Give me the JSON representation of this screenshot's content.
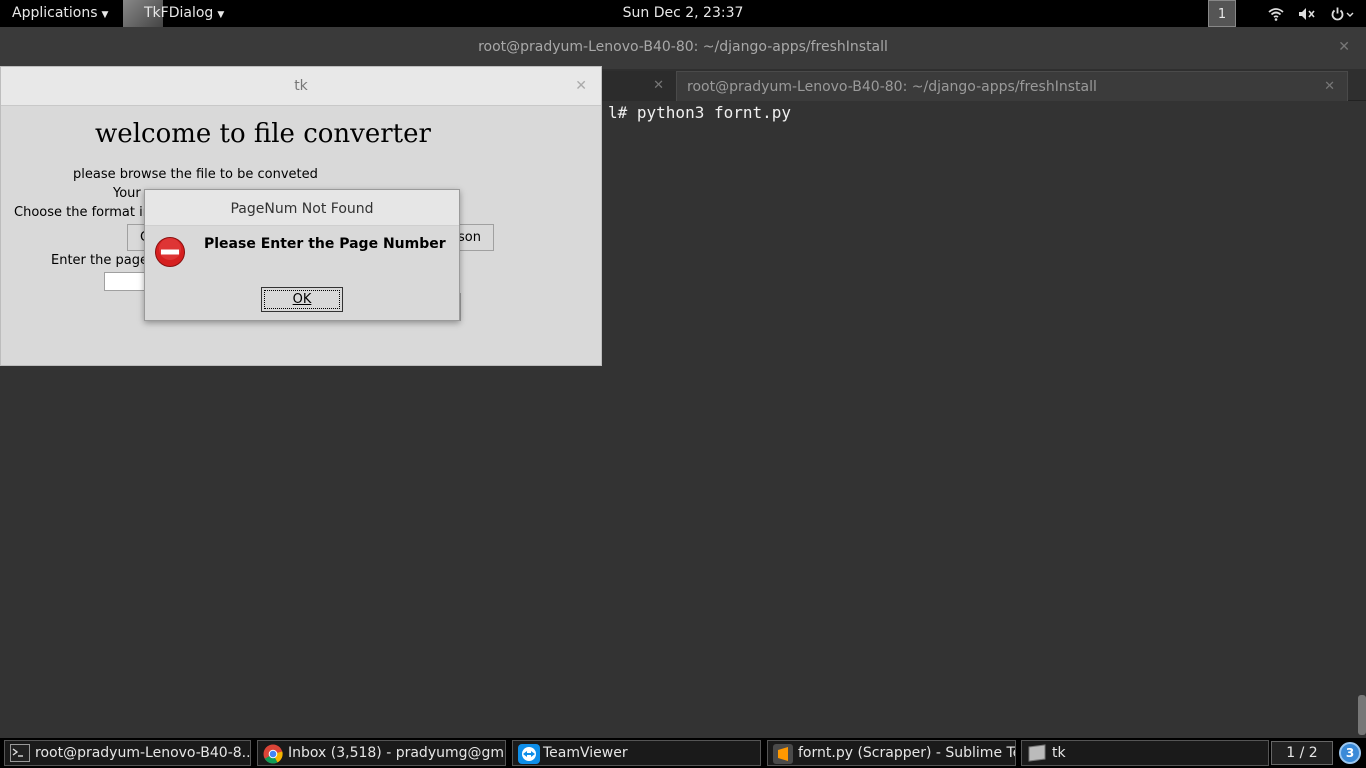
{
  "topbar": {
    "applications": "Applications",
    "active_app": "TkFDialog",
    "clock": "Sun Dec  2, 23:37",
    "workspace": "1"
  },
  "terminal": {
    "title": "root@pradyum-Lenovo-B40-80: ~/django-apps/freshInstall",
    "tab2_title": "root@pradyum-Lenovo-B40-80: ~/django-apps/freshInstall",
    "command_line": "l# python3 fornt.py"
  },
  "tk_window": {
    "title": "tk",
    "heading": "welcome to file converter",
    "browse_label": "please browse the file to be conveted",
    "your_label": "Your",
    "format_label": "Choose the format in",
    "left_button": "C",
    "json_button": "son",
    "page_label": "Enter the page"
  },
  "dialog": {
    "title": "PageNum Not Found",
    "message": "Please Enter the Page Number",
    "ok": "OK"
  },
  "taskbar": {
    "items": [
      {
        "label": "root@pradyum-Lenovo-B40-8...",
        "icon": "terminal-icon"
      },
      {
        "label": "Inbox (3,518) - pradyumg@gm...",
        "icon": "chrome-icon"
      },
      {
        "label": "TeamViewer",
        "icon": "teamviewer-icon"
      },
      {
        "label": "fornt.py (Scrapper) - Sublime Te...",
        "icon": "sublime-icon"
      },
      {
        "label": "tk",
        "icon": "window-icon"
      }
    ],
    "pager": "1 / 2",
    "notifications": "3"
  },
  "colors": {
    "topbar_bg": "#000000",
    "terminal_bg": "#333333",
    "tk_bg": "#d9d9d9",
    "error_red": "#d62020",
    "notif_blue": "#3a8ad8"
  }
}
